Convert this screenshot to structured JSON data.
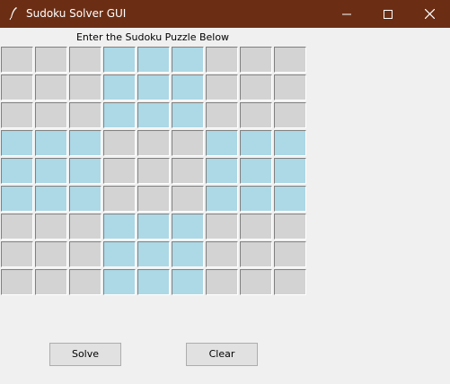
{
  "window": {
    "title": "Sudoku Solver GUI",
    "icon": "feather-icon",
    "controls": [
      "minimize-icon",
      "maximize-icon",
      "close-icon"
    ]
  },
  "heading": "Enter the Sudoku Puzzle Below",
  "grid": {
    "rows": 9,
    "cols": 9,
    "values": [
      [
        "",
        "",
        "",
        "",
        "",
        "",
        "",
        "",
        ""
      ],
      [
        "",
        "",
        "",
        "",
        "",
        "",
        "",
        "",
        ""
      ],
      [
        "",
        "",
        "",
        "",
        "",
        "",
        "",
        "",
        ""
      ],
      [
        "",
        "",
        "",
        "",
        "",
        "",
        "",
        "",
        ""
      ],
      [
        "",
        "",
        "",
        "",
        "",
        "",
        "",
        "",
        ""
      ],
      [
        "",
        "",
        "",
        "",
        "",
        "",
        "",
        "",
        ""
      ],
      [
        "",
        "",
        "",
        "",
        "",
        "",
        "",
        "",
        ""
      ],
      [
        "",
        "",
        "",
        "",
        "",
        "",
        "",
        "",
        ""
      ],
      [
        "",
        "",
        "",
        "",
        "",
        "",
        "",
        "",
        ""
      ]
    ],
    "colors": {
      "gray_box": "#d3d3d3",
      "blue_box": "#add8e6"
    }
  },
  "buttons": {
    "solve": "Solve",
    "clear": "Clear"
  },
  "colors": {
    "titlebar": "#6b2e14",
    "background": "#f0f0f0"
  }
}
